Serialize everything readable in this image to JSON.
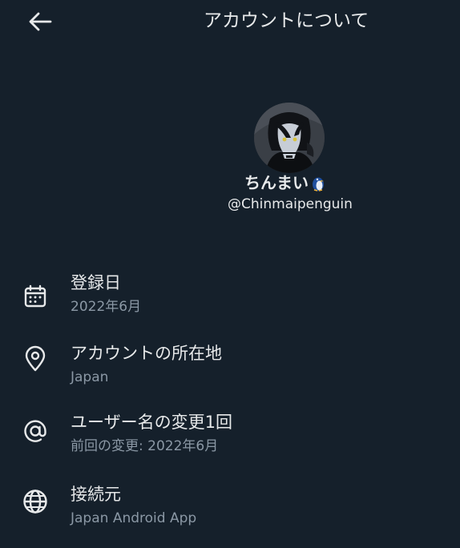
{
  "header": {
    "back_icon": "arrow-left-icon",
    "title": "アカウントについて"
  },
  "profile": {
    "avatar_icon": "user-avatar",
    "display_name": "ちんまい",
    "name_emoji": "penguin-emoji",
    "handle": "@Chinmaipenguin"
  },
  "info": [
    {
      "icon": "calendar-icon",
      "label": "登録日",
      "value": "2022年6月"
    },
    {
      "icon": "location-pin-icon",
      "label": "アカウントの所在地",
      "value": "Japan"
    },
    {
      "icon": "at-sign-icon",
      "label": "ユーザー名の変更1回",
      "value": "前回の変更: 2022年6月"
    },
    {
      "icon": "globe-icon",
      "label": "接続元",
      "value": "Japan Android App"
    }
  ],
  "colors": {
    "background": "#15202b",
    "primary_text": "#e7e9ea",
    "secondary_text": "#8b98a5"
  }
}
